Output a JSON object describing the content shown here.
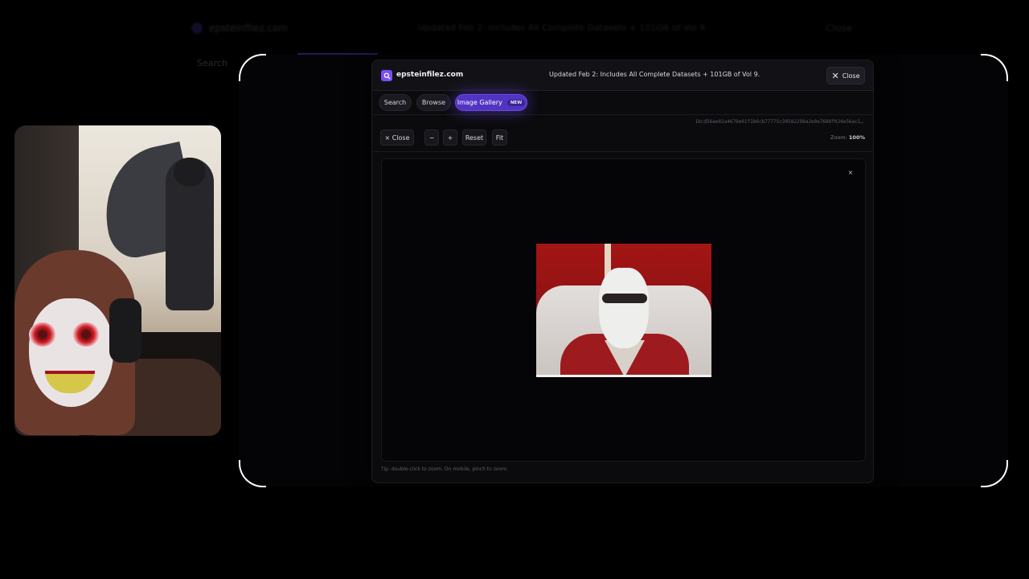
{
  "background_page": {
    "site_name": "epsteinfilez.com",
    "banner": "Updated Feb 2: Includes All Complete Datasets + 101GB of Vol 9.",
    "close_label": "Close",
    "tab_label": "Search"
  },
  "modal": {
    "site_name": "epsteinfilez.com",
    "banner": "Updated Feb 2: Includes All Complete Datasets + 101GB of Vol 9.",
    "close_label": "Close",
    "tabs": [
      {
        "label": "Search"
      },
      {
        "label": "Browse"
      },
      {
        "label": "Image Gallery",
        "badge": "NEW",
        "active": true
      }
    ],
    "file_hash": "1bcd56ae02a4679e01f1b6cb77775c30582298a2e0e7688f024e56ac1…",
    "toolbar": {
      "close_label": "× Close",
      "zoom_out_label": "−",
      "zoom_in_label": "+",
      "reset_label": "Reset",
      "fit_label": "Fit",
      "zoom_prefix": "Zoom:",
      "zoom_value": "100%"
    },
    "viewer_close": "×",
    "tip": "Tip: double-click to zoom. On mobile, pinch to zoom."
  },
  "colors": {
    "accent": "#5234c2",
    "badge_bg": "#3a2491",
    "modal_bg": "#0b0b0e",
    "page_bg": "#000000"
  },
  "icons": {
    "logo": "search-icon",
    "close": "close-icon"
  }
}
